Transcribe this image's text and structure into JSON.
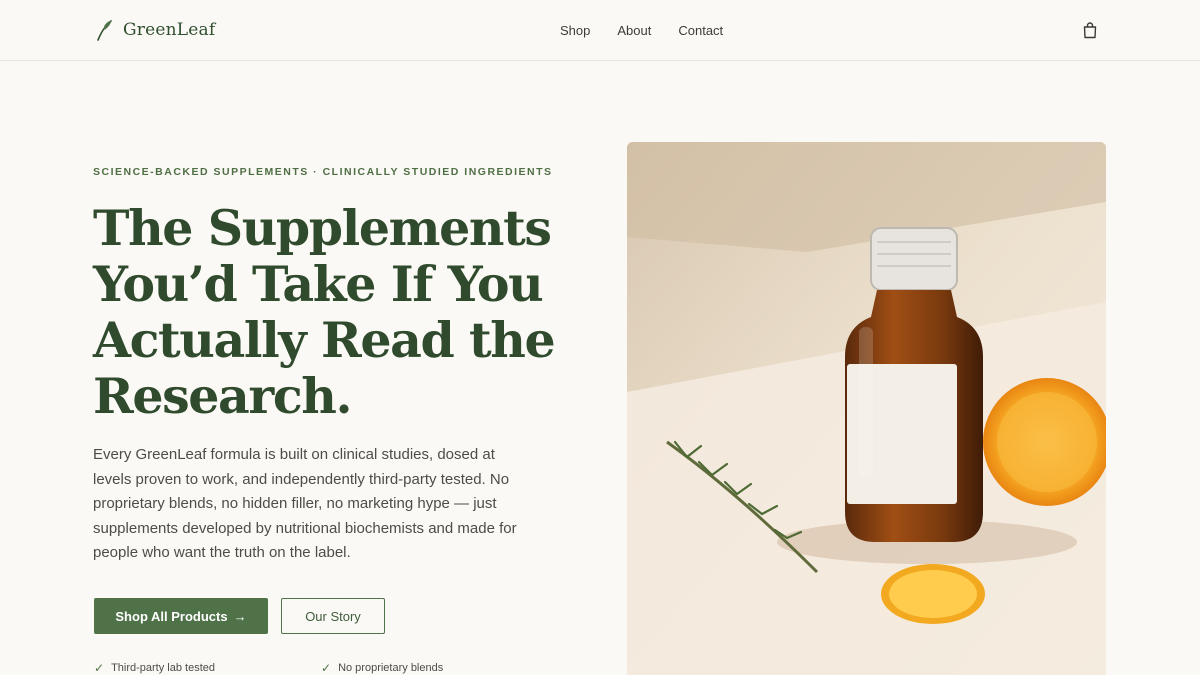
{
  "header": {
    "brand": "GreenLeaf",
    "brand_icon": "leaf-icon",
    "nav": [
      {
        "label": "Shop"
      },
      {
        "label": "About"
      },
      {
        "label": "Contact"
      }
    ],
    "cart_icon": "shopping-bag-icon"
  },
  "hero": {
    "eyebrow": "SCIENCE-BACKED SUPPLEMENTS · CLINICALLY STUDIED INGREDIENTS",
    "headline_lines": [
      "The Supplements",
      "You’d Take If You",
      "Actually Read the",
      "Research."
    ],
    "intro": "Every GreenLeaf formula is built on clinical studies, dosed at levels proven to work, and independently third-party tested. No proprietary blends, no hidden filler, no marketing hype — just supplements developed by nutritional biochemists and made for people who want the truth on the label.",
    "primary_cta": "Shop All Products",
    "primary_cta_arrow": "→",
    "secondary_cta": "Our Story",
    "perks": [
      {
        "icon": "check-icon",
        "label": "Third-party lab tested"
      },
      {
        "icon": "check-icon",
        "label": "No proprietary blends"
      }
    ]
  },
  "colors": {
    "background": "#fbf9f5",
    "brand_green": "#2f4a2c",
    "button_green": "#4f7248",
    "accent_text": "#4f6f45"
  }
}
